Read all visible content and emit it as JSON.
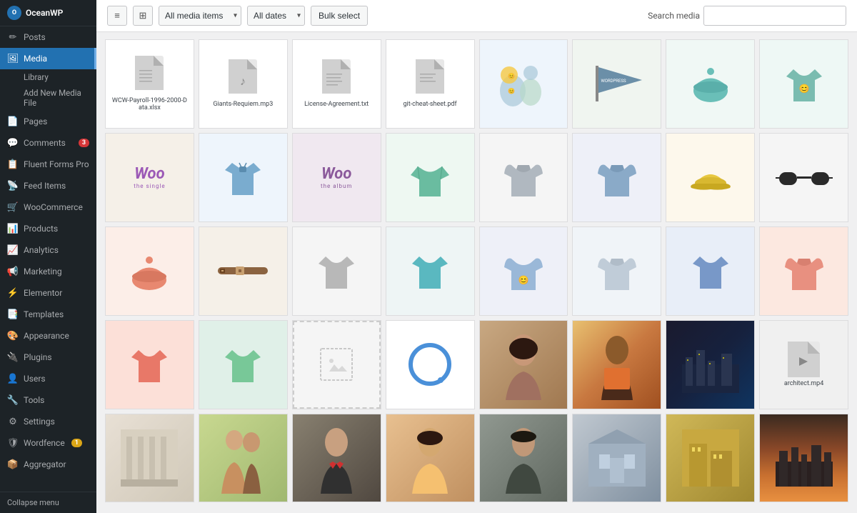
{
  "sidebar": {
    "site_name": "OceanWP",
    "items": [
      {
        "id": "posts",
        "label": "Posts",
        "icon": "✏",
        "active": false
      },
      {
        "id": "media",
        "label": "Media",
        "icon": "🖼",
        "active": true
      },
      {
        "id": "library",
        "label": "Library",
        "sub": true
      },
      {
        "id": "add-new",
        "label": "Add New Media File",
        "sub": true
      },
      {
        "id": "pages",
        "label": "Pages",
        "icon": "📄",
        "active": false
      },
      {
        "id": "comments",
        "label": "Comments",
        "icon": "💬",
        "active": false,
        "badge": "3"
      },
      {
        "id": "fluent-forms",
        "label": "Fluent Forms Pro",
        "icon": "📋",
        "active": false
      },
      {
        "id": "feed-items",
        "label": "Feed Items",
        "icon": "📡",
        "active": false
      },
      {
        "id": "woocommerce",
        "label": "WooCommerce",
        "icon": "🛒",
        "active": false
      },
      {
        "id": "products",
        "label": "Products",
        "icon": "📊",
        "active": false
      },
      {
        "id": "analytics",
        "label": "Analytics",
        "icon": "📈",
        "active": false
      },
      {
        "id": "marketing",
        "label": "Marketing",
        "icon": "📢",
        "active": false
      },
      {
        "id": "elementor",
        "label": "Elementor",
        "icon": "⚡",
        "active": false
      },
      {
        "id": "templates",
        "label": "Templates",
        "icon": "📑",
        "active": false
      },
      {
        "id": "appearance",
        "label": "Appearance",
        "icon": "🎨",
        "active": false
      },
      {
        "id": "plugins",
        "label": "Plugins",
        "icon": "🔌",
        "active": false
      },
      {
        "id": "users",
        "label": "Users",
        "icon": "👤",
        "active": false
      },
      {
        "id": "tools",
        "label": "Tools",
        "icon": "🔧",
        "active": false
      },
      {
        "id": "settings",
        "label": "Settings",
        "icon": "⚙",
        "active": false
      },
      {
        "id": "wordfence",
        "label": "Wordfence",
        "icon": "🛡",
        "active": false,
        "badge": "1"
      },
      {
        "id": "aggregator",
        "label": "Aggregator",
        "icon": "📦",
        "active": false
      }
    ],
    "collapse_label": "Collapse menu"
  },
  "toolbar": {
    "view_list_label": "≡",
    "view_grid_label": "⊞",
    "filter_all_label": "All media items",
    "filter_dates_label": "All dates",
    "bulk_select_label": "Bulk select",
    "search_label": "Search media",
    "search_placeholder": ""
  },
  "media": {
    "items": [
      {
        "id": "wcw-payroll",
        "type": "file",
        "icon": "📊",
        "name": "WCW-Payroll-1996-2000-Data.xlsx"
      },
      {
        "id": "giants-requiem",
        "type": "file",
        "icon": "🎵",
        "name": "Giants-Requiem.mp3"
      },
      {
        "id": "license-agreement",
        "type": "file",
        "icon": "📄",
        "name": "License-Agreement.txt"
      },
      {
        "id": "git-cheat-sheet",
        "type": "file",
        "icon": "📄",
        "name": "git-cheat-sheet.pdf"
      },
      {
        "id": "tshirt-group1",
        "type": "image",
        "color": "#e8f2f0"
      },
      {
        "id": "pennant",
        "type": "image",
        "color": "#e8f0e8"
      },
      {
        "id": "beanie-teal",
        "type": "image",
        "color": "#e0f0ec"
      },
      {
        "id": "tshirt-teal",
        "type": "image",
        "color": "#e0eeec"
      },
      {
        "id": "woo-single",
        "type": "woo",
        "style": "single"
      },
      {
        "id": "polo-blue",
        "type": "image",
        "color": "#e8f0f8"
      },
      {
        "id": "woo-album",
        "type": "woo",
        "style": "album"
      },
      {
        "id": "sweater-teal",
        "type": "image",
        "color": "#e0f0e8"
      },
      {
        "id": "hoodie-gray",
        "type": "image",
        "color": "#f0f0f0"
      },
      {
        "id": "hoodie-blue",
        "type": "image",
        "color": "#e8eeF5"
      },
      {
        "id": "cap-yellow",
        "type": "image",
        "color": "#faf5e0"
      },
      {
        "id": "sunglasses",
        "type": "image",
        "color": "#f0f0f0"
      },
      {
        "id": "beanie-pink",
        "type": "image",
        "color": "#fce8e0"
      },
      {
        "id": "belt-brown",
        "type": "image",
        "color": "#f0ece4"
      },
      {
        "id": "tshirt-gray",
        "type": "image",
        "color": "#f0f0f0"
      },
      {
        "id": "tshirt-teal2",
        "type": "image",
        "color": "#e0eeee"
      },
      {
        "id": "hoodie-emoji",
        "type": "image",
        "color": "#e8f0f8"
      },
      {
        "id": "hoodie-light",
        "type": "image",
        "color": "#e8eef5"
      },
      {
        "id": "tshirt-blue2",
        "type": "image",
        "color": "#dde8f5"
      },
      {
        "id": "hoodie-peach",
        "type": "image",
        "color": "#fce8e0"
      },
      {
        "id": "tshirt-pink",
        "type": "image",
        "color": "#fce0d8"
      },
      {
        "id": "tshirt-mint",
        "type": "image",
        "color": "#e0f0e8"
      },
      {
        "id": "missing",
        "type": "missing"
      },
      {
        "id": "circle-logo",
        "type": "circle"
      },
      {
        "id": "woman1",
        "type": "photo",
        "grad": "grad-woman"
      },
      {
        "id": "man-colorful",
        "type": "photo",
        "grad": "grad-man1"
      },
      {
        "id": "city-night",
        "type": "photo",
        "grad": "grad-night"
      },
      {
        "id": "video-architect",
        "type": "video",
        "name": "architect.mp4"
      },
      {
        "id": "pillars",
        "type": "photo",
        "grad": "grad-pillar"
      },
      {
        "id": "couple",
        "type": "photo",
        "grad": "grad-couple"
      },
      {
        "id": "man-bowtie",
        "type": "photo",
        "grad": "grad-man2"
      },
      {
        "id": "woman-smile",
        "type": "photo",
        "grad": "grad-woman2"
      },
      {
        "id": "man-laugh",
        "type": "photo",
        "grad": "grad-man3"
      },
      {
        "id": "architecture",
        "type": "photo",
        "grad": "grad-arch"
      },
      {
        "id": "building",
        "type": "photo",
        "grad": "grad-build"
      },
      {
        "id": "dusk-city",
        "type": "photo",
        "grad": "grad-dusk"
      }
    ]
  }
}
